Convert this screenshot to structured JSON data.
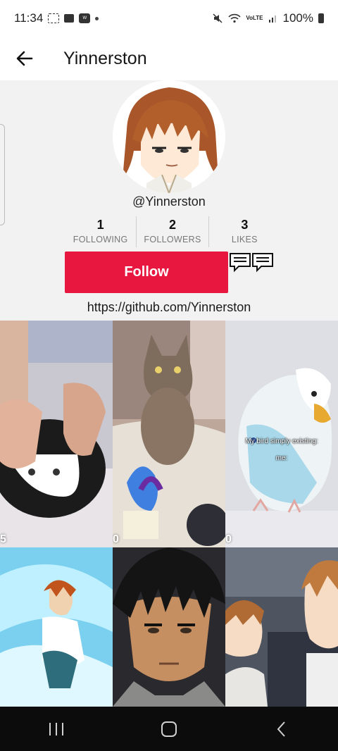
{
  "status_bar": {
    "time": "11:34",
    "battery": "100%",
    "network_label": "VoLTE"
  },
  "header": {
    "title": "Yinnerston"
  },
  "profile": {
    "handle": "@Yinnerston",
    "stats": [
      {
        "value": "1",
        "label": "FOLLOWING"
      },
      {
        "value": "2",
        "label": "FOLLOWERS"
      },
      {
        "value": "3",
        "label": "LIKES"
      }
    ],
    "follow_label": "Follow",
    "website": "https://github.com/Yinnerston"
  },
  "videos": [
    {
      "count": "5",
      "caption": ""
    },
    {
      "count": "0",
      "caption": ""
    },
    {
      "count": "0",
      "caption": "My bird simply existing:",
      "caption2": "me:"
    },
    {
      "count": "",
      "caption": ""
    },
    {
      "count": "",
      "caption": ""
    },
    {
      "count": "",
      "caption": ""
    }
  ]
}
